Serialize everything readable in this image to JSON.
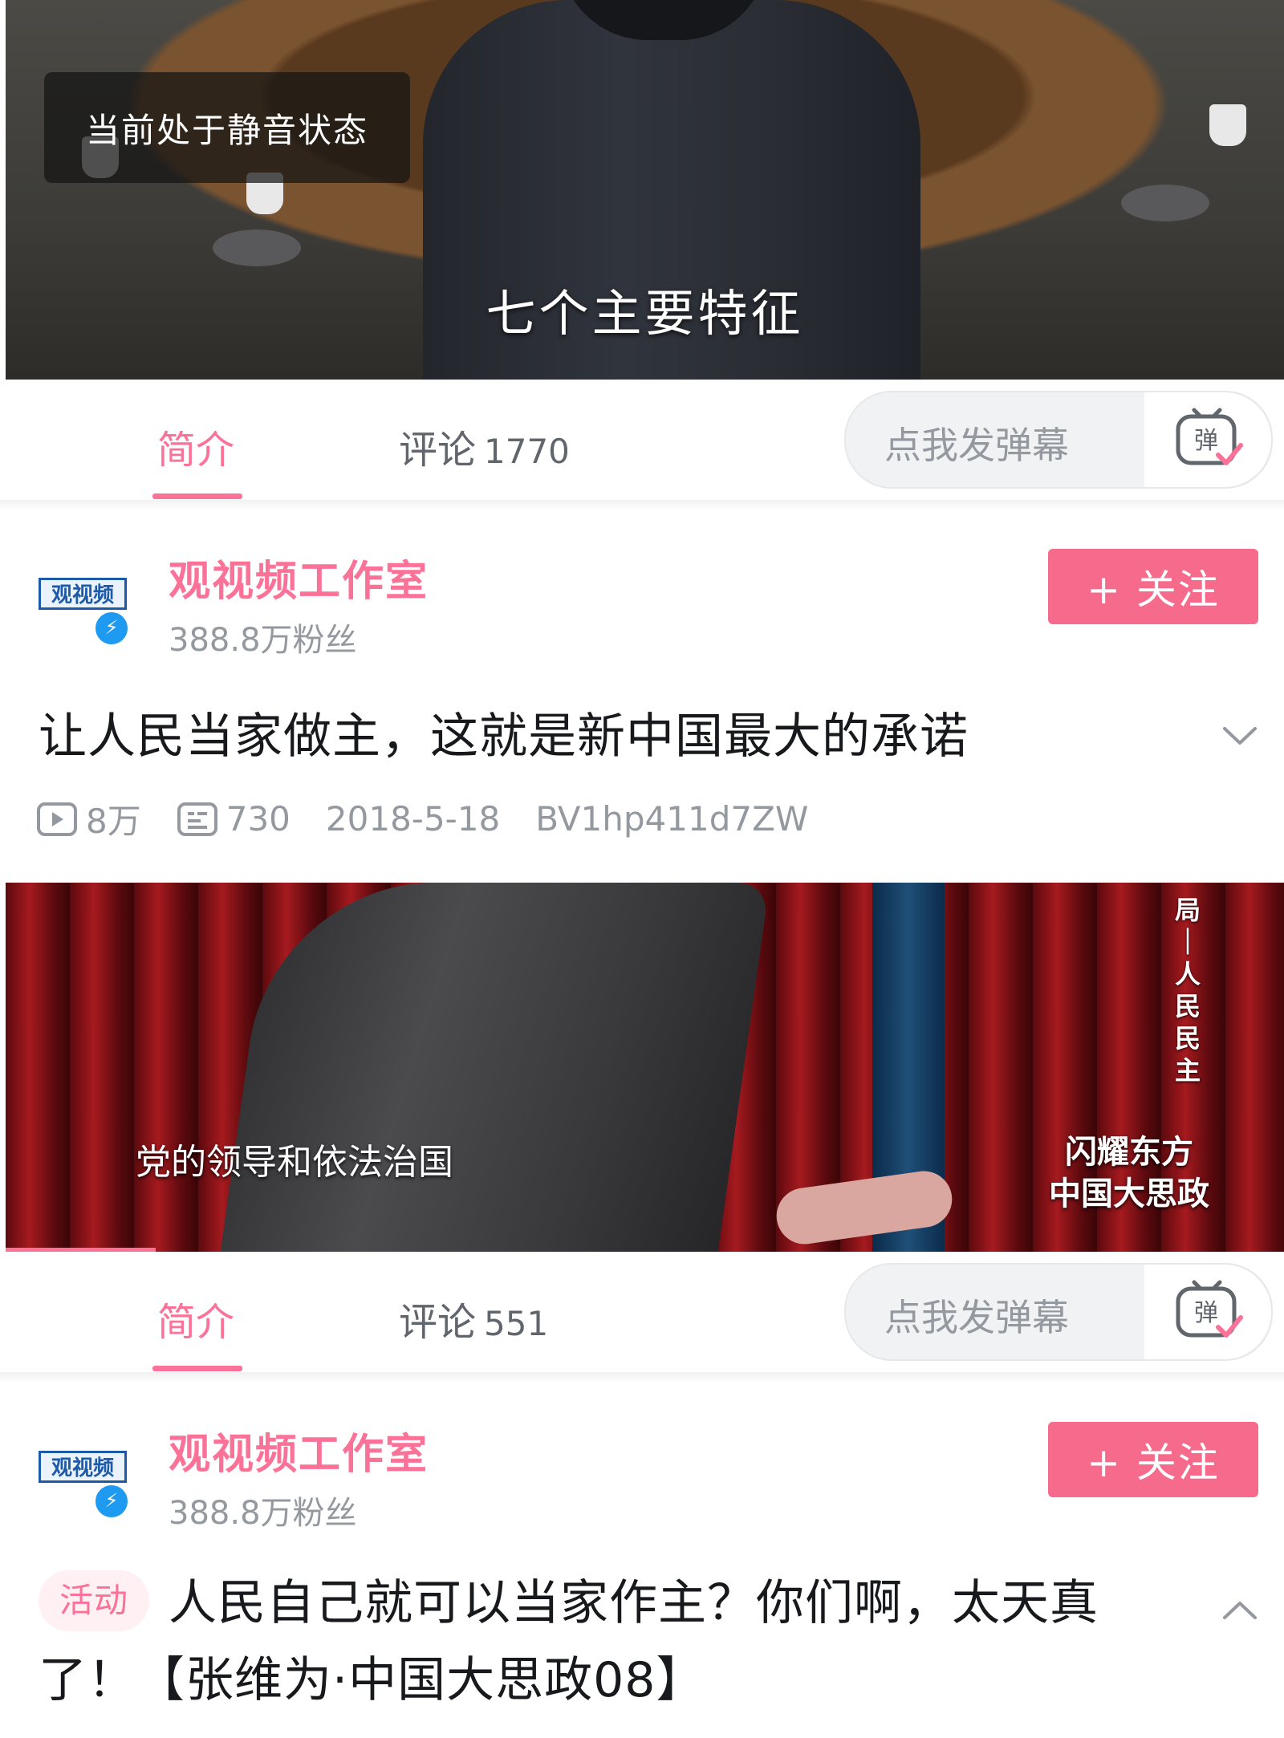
{
  "sections": [
    {
      "video": {
        "mute_notice": "当前处于静音状态",
        "subtitle": "七个主要特征"
      },
      "tabs": {
        "intro": "简介",
        "comments_label": "评论",
        "comments_count": "1770"
      },
      "danmaku": {
        "placeholder": "点我发弹幕",
        "icon": "danmaku-icon"
      },
      "uploader": {
        "name": "观视频工作室",
        "fans": "388.8万粉丝",
        "avatar_text": "观视频",
        "follow": "+ 关注"
      },
      "video_title": "让人民当家做主，这就是新中国最大的承诺",
      "meta": {
        "views": "8万",
        "danmaku_count": "730",
        "date": "2018-5-18",
        "bvid": "BV1hp411d7ZW"
      }
    },
    {
      "video": {
        "caption": "党的领导和依法治国",
        "vertical_text": "局｜人民民主",
        "logo_line1": "闪耀东方",
        "logo_line2": "中国大思政"
      },
      "tabs": {
        "intro": "简介",
        "comments_label": "评论",
        "comments_count": "551"
      },
      "danmaku": {
        "placeholder": "点我发弹幕",
        "icon": "danmaku-icon"
      },
      "uploader": {
        "name": "观视频工作室",
        "fans": "388.8万粉丝",
        "avatar_text": "观视频",
        "follow": "+ 关注"
      },
      "activity_tag": "活动",
      "video_title": "人民自己就可以当家作主？你们啊，太天真了！【张维为·中国大思政08】"
    }
  ],
  "colors": {
    "accent": "#fb7299",
    "follow_bg": "#f66b8c",
    "muted": "#9499a0"
  }
}
